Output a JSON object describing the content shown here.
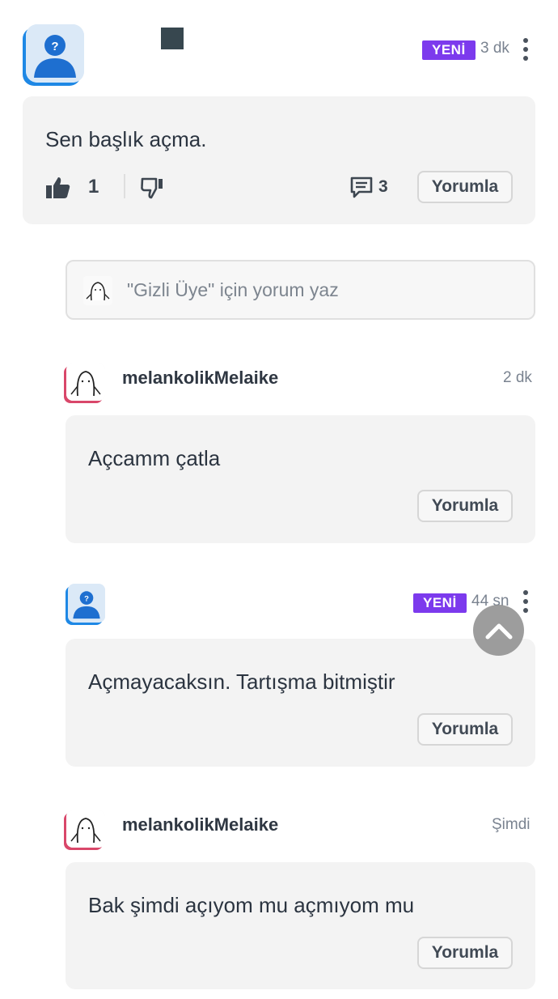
{
  "post": {
    "badge": "YENİ",
    "time": "3 dk",
    "text": "Sen başlık açma.",
    "like_count": "1",
    "comment_count": "3",
    "comment_button": "Yorumla"
  },
  "reply_input": {
    "placeholder": "\"Gizli Üye\" için yorum yaz"
  },
  "replies": [
    {
      "username": "melankolikMelaike",
      "time": "2 dk",
      "text": "Açcamm çatla",
      "button": "Yorumla"
    },
    {
      "username": "",
      "badge": "YENİ",
      "time": "44 sn",
      "text": "Açmayacaksın. Tartışma bitmiştir",
      "button": "Yorumla"
    },
    {
      "username": "melankolikMelaike",
      "time": "Şimdi",
      "text": "Bak şimdi açıyom mu açmıyom mu",
      "button": "Yorumla"
    }
  ],
  "colors": {
    "badge_bg": "#7c3aed",
    "card_bg": "#f3f3f3",
    "avatar_accent_blue": "#1e88e5",
    "avatar_accent_pink": "#d9476a"
  },
  "icons": [
    "anonymous-avatar-icon",
    "drawing-avatar-icon",
    "thumbs-up-icon",
    "thumbs-down-icon",
    "comment-bubble-icon",
    "more-vert-icon",
    "chevron-up-icon"
  ]
}
